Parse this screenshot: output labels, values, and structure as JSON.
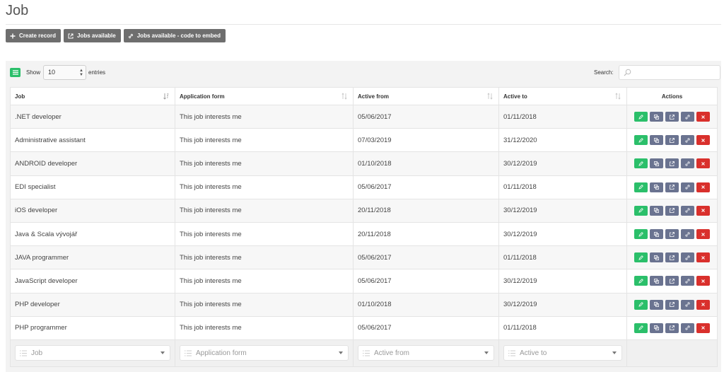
{
  "page": {
    "title": "Job"
  },
  "toolbar": {
    "create_label": "Create record",
    "jobs_label": "Jobs available",
    "embed_label": "Jobs available - code to embed"
  },
  "table_controls": {
    "show_label": "Show",
    "length_value": "10",
    "entries_label": "entries",
    "search_label": "Search:"
  },
  "columns": [
    "Job",
    "Application form",
    "Active from",
    "Active to",
    "Actions"
  ],
  "rows": [
    {
      "job": ".NET developer",
      "form": "This job interests me",
      "from": "05/06/2017",
      "to": "01/11/2018"
    },
    {
      "job": "Administrative assistant",
      "form": "This job interests me",
      "from": "07/03/2019",
      "to": "31/12/2020"
    },
    {
      "job": "ANDROID developer",
      "form": "This job interests me",
      "from": "01/10/2018",
      "to": "30/12/2019"
    },
    {
      "job": "EDI specialist",
      "form": "This job interests me",
      "from": "05/06/2017",
      "to": "01/11/2018"
    },
    {
      "job": "iOS developer",
      "form": "This job interests me",
      "from": "20/11/2018",
      "to": "30/12/2019"
    },
    {
      "job": "Java & Scala vývojář",
      "form": "This job interests me",
      "from": "20/11/2018",
      "to": "30/12/2019"
    },
    {
      "job": "JAVA programmer",
      "form": "This job interests me",
      "from": "05/06/2017",
      "to": "01/11/2018"
    },
    {
      "job": "JavaScript developer",
      "form": "This job interests me",
      "from": "05/06/2017",
      "to": "30/12/2019"
    },
    {
      "job": "PHP developer",
      "form": "This job interests me",
      "from": "01/10/2018",
      "to": "30/12/2019"
    },
    {
      "job": "PHP programmer",
      "form": "This job interests me",
      "from": "05/06/2017",
      "to": "01/11/2018"
    }
  ],
  "filters": [
    "Job",
    "Application form",
    "Active from",
    "Active to"
  ],
  "colors": {
    "edit": "#2bbf6a",
    "secondary": "#6a7390",
    "delete": "#d9302c",
    "toolbar": "#6e6e6e"
  }
}
